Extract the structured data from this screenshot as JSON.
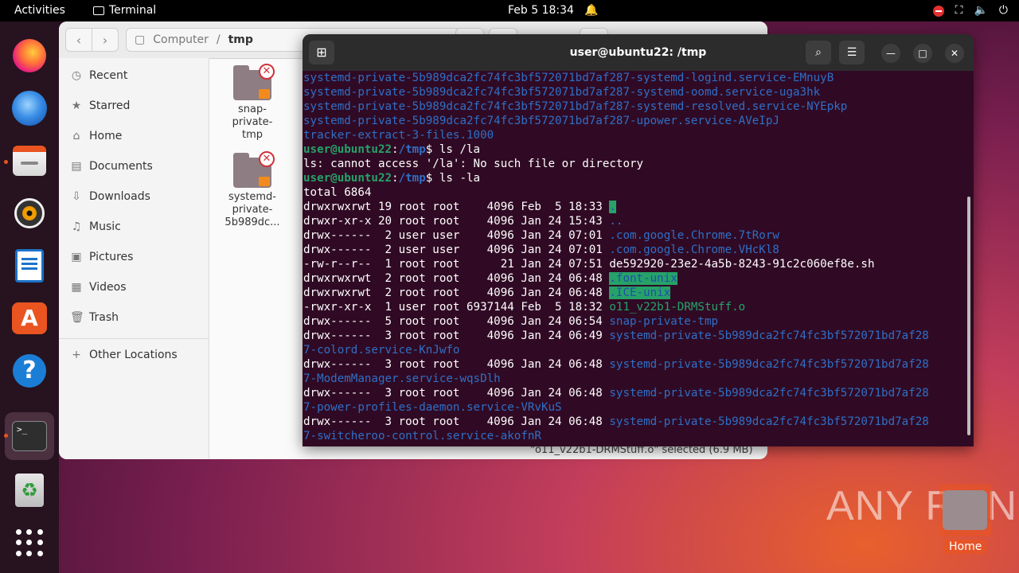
{
  "topbar": {
    "activities": "Activities",
    "app_name": "Terminal",
    "clock": "Feb 5  18:34",
    "icons": [
      "bell-icon",
      "record-icon",
      "network-icon",
      "volume-icon",
      "power-icon"
    ]
  },
  "dock": {
    "apps": [
      "firefox",
      "thunderbird",
      "files",
      "rhythmbox",
      "libreoffice-writer",
      "app-center",
      "help",
      "terminal",
      "trash",
      "show-apps"
    ]
  },
  "files": {
    "path_root": "Computer",
    "path_current": "tmp",
    "sidebar": [
      {
        "label": "Recent",
        "icon": "clock-icon"
      },
      {
        "label": "Starred",
        "icon": "star-icon"
      },
      {
        "label": "Home",
        "icon": "home-icon"
      },
      {
        "label": "Documents",
        "icon": "document-icon"
      },
      {
        "label": "Downloads",
        "icon": "download-icon"
      },
      {
        "label": "Music",
        "icon": "music-icon"
      },
      {
        "label": "Pictures",
        "icon": "picture-icon"
      },
      {
        "label": "Videos",
        "icon": "video-icon"
      },
      {
        "label": "Trash",
        "icon": "trash-icon"
      },
      {
        "label": "Other Locations",
        "icon": "plus-icon"
      }
    ],
    "items": [
      {
        "name": "snap-\nprivate-\ntmp"
      },
      {
        "name": "systemd-\nprivate-\n5b989dc..."
      }
    ],
    "status": "\"o11_v22b1-DRMStuff.o\" selected  (6.9 MB)"
  },
  "terminal": {
    "title": "user@ubuntu22: /tmp",
    "prompt_user": "user@ubuntu22",
    "prompt_path": "/tmp",
    "lines": [
      {
        "cls": "blue",
        "text": "systemd-private-5b989dca2fc74fc3bf572071bd7af287-systemd-logind.service-EMnuyB"
      },
      {
        "cls": "blue",
        "text": "systemd-private-5b989dca2fc74fc3bf572071bd7af287-systemd-oomd.service-uga3hk"
      },
      {
        "cls": "blue",
        "text": "systemd-private-5b989dca2fc74fc3bf572071bd7af287-systemd-resolved.service-NYEpkp"
      },
      {
        "cls": "blue",
        "text": "systemd-private-5b989dca2fc74fc3bf572071bd7af287-upower.service-AVeIpJ"
      },
      {
        "cls": "blue",
        "text": "tracker-extract-3-files.1000"
      },
      {
        "prompt": true,
        "cmd": "$ ls /la"
      },
      {
        "cls": "",
        "text": "ls: cannot access '/la': No such file or directory"
      },
      {
        "prompt": true,
        "cmd": "$ ls -la"
      },
      {
        "cls": "",
        "text": "total 6864"
      },
      {
        "meta": "drwxrwxrwt 19 root root    4096 Feb  5 18:33 ",
        "name": ".",
        "ncls": "hl"
      },
      {
        "meta": "drwxr-xr-x 20 root root    4096 Jan 24 15:43 ",
        "name": "..",
        "ncls": "blue"
      },
      {
        "meta": "drwx------  2 user user    4096 Jan 24 07:01 ",
        "name": ".com.google.Chrome.7tRorw",
        "ncls": "blue"
      },
      {
        "meta": "drwx------  2 user user    4096 Jan 24 07:01 ",
        "name": ".com.google.Chrome.VHcKl8",
        "ncls": "blue"
      },
      {
        "meta": "-rw-r--r--  1 root root      21 Jan 24 07:51 ",
        "name": "de592920-23e2-4a5b-8243-91c2c060ef8e.sh",
        "ncls": ""
      },
      {
        "meta": "drwxrwxrwt  2 root root    4096 Jan 24 06:48 ",
        "name": ".font-unix",
        "ncls": "hl"
      },
      {
        "meta": "drwxrwxrwt  2 root root    4096 Jan 24 06:48 ",
        "name": ".ICE-unix",
        "ncls": "hl"
      },
      {
        "meta": "-rwxr-xr-x  1 user root 6937144 Feb  5 18:32 ",
        "name": "o11_v22b1-DRMStuff.o",
        "ncls": "green"
      },
      {
        "meta": "drwx------  5 root root    4096 Jan 24 06:54 ",
        "name": "snap-private-tmp",
        "ncls": "blue"
      },
      {
        "meta": "drwx------  3 root root    4096 Jan 24 06:49 ",
        "name": "systemd-private-5b989dca2fc74fc3bf572071bd7af28",
        "ncls": "blue"
      },
      {
        "cls": "blue",
        "text": "7-colord.service-KnJwfo"
      },
      {
        "meta": "drwx------  3 root root    4096 Jan 24 06:48 ",
        "name": "systemd-private-5b989dca2fc74fc3bf572071bd7af28",
        "ncls": "blue"
      },
      {
        "cls": "blue",
        "text": "7-ModemManager.service-wqsDlh"
      },
      {
        "meta": "drwx------  3 root root    4096 Jan 24 06:48 ",
        "name": "systemd-private-5b989dca2fc74fc3bf572071bd7af28",
        "ncls": "blue"
      },
      {
        "cls": "blue",
        "text": "7-power-profiles-daemon.service-VRvKuS"
      },
      {
        "meta": "drwx------  3 root root    4096 Jan 24 06:48 ",
        "name": "systemd-private-5b989dca2fc74fc3bf572071bd7af28",
        "ncls": "blue"
      },
      {
        "cls": "blue",
        "text": "7-switcheroo-control.service-akofnR"
      }
    ]
  },
  "watermark": "ANY RUN",
  "desktop": {
    "home_label": "Home"
  }
}
